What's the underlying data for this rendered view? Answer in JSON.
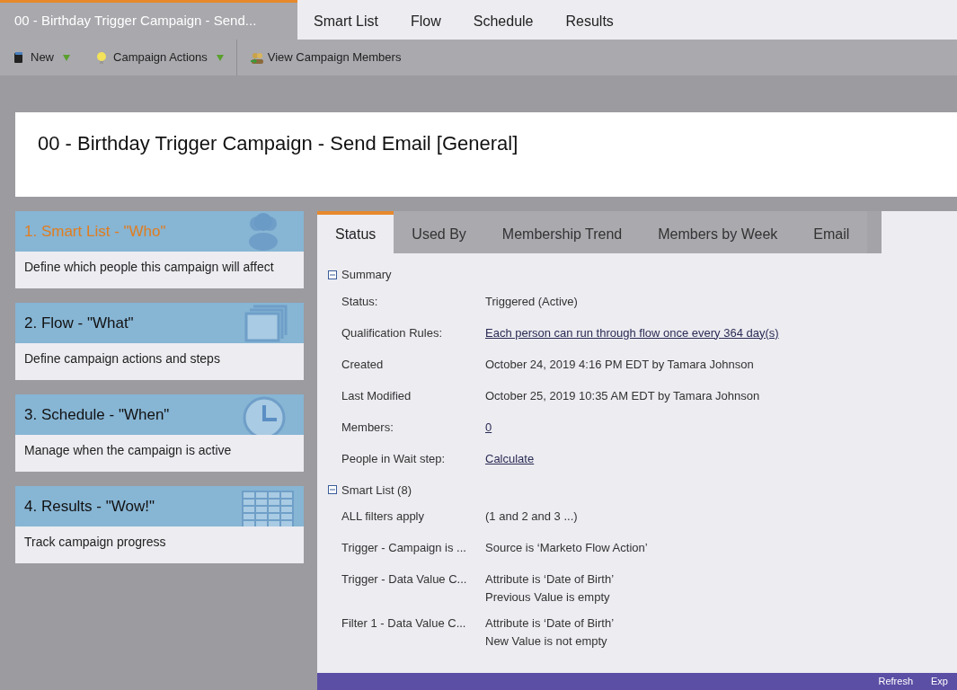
{
  "top_tabs": [
    {
      "label": "00 - Birthday Trigger Campaign - Send...",
      "selected": true
    },
    {
      "label": "Smart List",
      "selected": false
    },
    {
      "label": "Flow",
      "selected": false
    },
    {
      "label": "Schedule",
      "selected": false
    },
    {
      "label": "Results",
      "selected": false
    }
  ],
  "toolbar": [
    {
      "label": "New",
      "dropdown": true
    },
    {
      "label": "Campaign Actions",
      "dropdown": true
    },
    {
      "label": "View Campaign Members",
      "dropdown": false
    }
  ],
  "header": {
    "title": "00 - Birthday Trigger Campaign - Send Email [General]"
  },
  "steps": [
    {
      "title": "1. Smart List - \"Who\"",
      "description": "Define which people this campaign will affect",
      "selected": true
    },
    {
      "title": "2. Flow - \"What\"",
      "description": "Define campaign actions and steps",
      "selected": false
    },
    {
      "title": "3. Schedule - \"When\"",
      "description": "Manage when the campaign is active",
      "selected": false
    },
    {
      "title": "4. Results - \"Wow!\"",
      "description": "Track campaign progress",
      "selected": false
    }
  ],
  "detail_tabs": [
    {
      "label": "Status",
      "selected": true
    },
    {
      "label": "Used By",
      "selected": false
    },
    {
      "label": "Membership Trend",
      "selected": false
    },
    {
      "label": "Members by Week",
      "selected": false
    },
    {
      "label": "Email",
      "selected": false
    }
  ],
  "sections": [
    {
      "title": "Summary",
      "expanded": true,
      "rows": [
        {
          "label": "Status:",
          "value": [
            "Triggered (Active)"
          ],
          "link": false
        },
        {
          "label": "Qualification Rules:",
          "value": [
            "Each person can run through flow once every 364 day(s)"
          ],
          "link": true
        },
        {
          "label": "Created",
          "value": [
            "October 24, 2019 4:16 PM EDT by Tamara Johnson"
          ],
          "link": false
        },
        {
          "label": "Last Modified",
          "value": [
            "October 25, 2019 10:35 AM EDT by Tamara Johnson"
          ],
          "link": false
        },
        {
          "label": "Members:",
          "value": [
            "0"
          ],
          "link": true
        },
        {
          "label": "People in Wait step:",
          "value": [
            "Calculate"
          ],
          "link": true
        }
      ]
    },
    {
      "title": "Smart List (8)",
      "expanded": true,
      "rows": [
        {
          "label": "ALL filters apply",
          "value": [
            "(1 and 2 and 3 ...)"
          ],
          "link": false
        },
        {
          "label": "Trigger - Campaign is ...",
          "value": [
            "Source is ‘Marketo Flow Action’"
          ],
          "link": false
        },
        {
          "label": "Trigger - Data Value C...",
          "value": [
            "Attribute is ‘Date of Birth’",
            "Previous Value is empty"
          ],
          "link": false
        },
        {
          "label": "Filter 1 - Data Value C...",
          "value": [
            "Attribute is ‘Date of Birth’",
            "New Value is not empty"
          ],
          "link": false
        }
      ]
    }
  ],
  "footer": {
    "buttons": [
      "Refresh",
      "Exp"
    ]
  }
}
